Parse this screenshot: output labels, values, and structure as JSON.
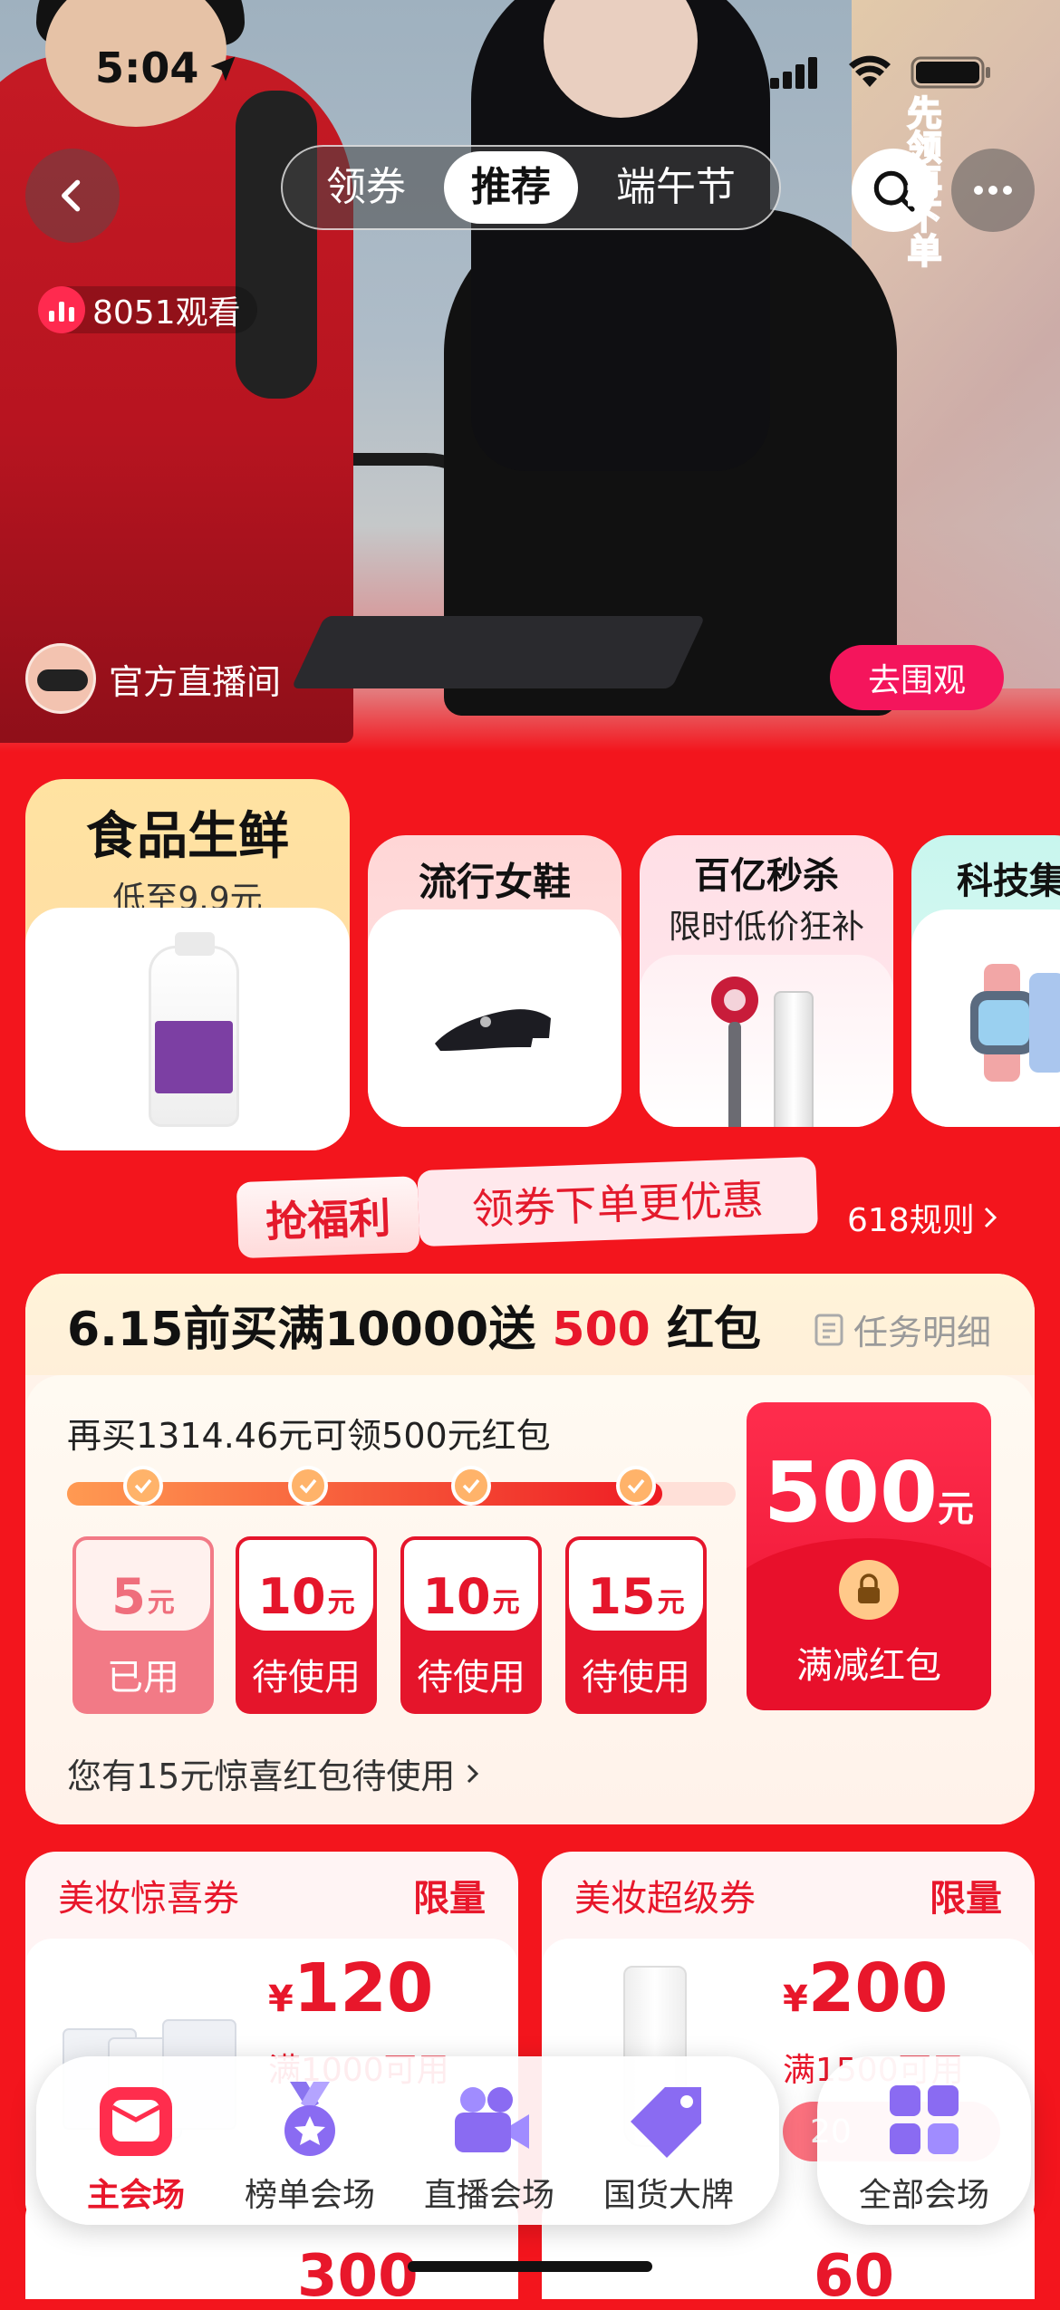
{
  "status": {
    "time": "5:04"
  },
  "nav": {
    "tabs": [
      {
        "label": "领券",
        "active": false
      },
      {
        "label": "推荐",
        "active": true
      },
      {
        "label": "端午节",
        "active": false
      }
    ]
  },
  "live": {
    "viewers": "8051观看",
    "host_name": "官方直播间",
    "watch_button": "去围观",
    "side_banner": "先领再下单"
  },
  "categories": [
    {
      "title": "食品生鲜",
      "subtitle": "低至9.9元"
    },
    {
      "title": "流行女鞋"
    },
    {
      "title": "百亿秒杀",
      "subtitle": "限时低价狂补"
    },
    {
      "title": "科技集"
    }
  ],
  "benefit": {
    "tag": "抢福利",
    "text": "领券下单更优惠",
    "rules_link": "618规则"
  },
  "task": {
    "title_pre": "6.15前买满10000送 ",
    "title_amount": "500",
    "title_post": " 红包",
    "detail_link": "任务明细",
    "progress_text": "再买1314.46元可领500元红包",
    "progress_fraction": 0.89,
    "coupons": [
      {
        "amount": "5",
        "unit": "元",
        "status": "已用"
      },
      {
        "amount": "10",
        "unit": "元",
        "status": "待使用"
      },
      {
        "amount": "10",
        "unit": "元",
        "status": "待使用"
      },
      {
        "amount": "15",
        "unit": "元",
        "status": "待使用"
      }
    ],
    "big_packet": {
      "amount": "500",
      "unit": "元",
      "label": "满减红包"
    },
    "surprise_text": "您有15元惊喜红包待使用"
  },
  "beauty": [
    {
      "name": "美妆惊喜券",
      "limit": "限量",
      "currency": "¥",
      "price": "120",
      "condition": "满1000可用",
      "peek_price": "300"
    },
    {
      "name": "美妆超级券",
      "limit": "限量",
      "currency": "¥",
      "price": "200",
      "condition": "满1500可用",
      "peek_price": "60",
      "button_partial": "20"
    }
  ],
  "dock": {
    "items": [
      {
        "label": "主会场",
        "active": true,
        "icon": "main-venue-icon"
      },
      {
        "label": "榜单会场",
        "active": false,
        "icon": "medal-icon"
      },
      {
        "label": "直播会场",
        "active": false,
        "icon": "video-camera-icon"
      },
      {
        "label": "国货大牌",
        "active": false,
        "icon": "price-tag-icon"
      }
    ],
    "all_label": "全部会场"
  },
  "colors": {
    "accent": "#e8172b",
    "page_bg": "#f3151d",
    "watch_btn": "#f4155c"
  }
}
